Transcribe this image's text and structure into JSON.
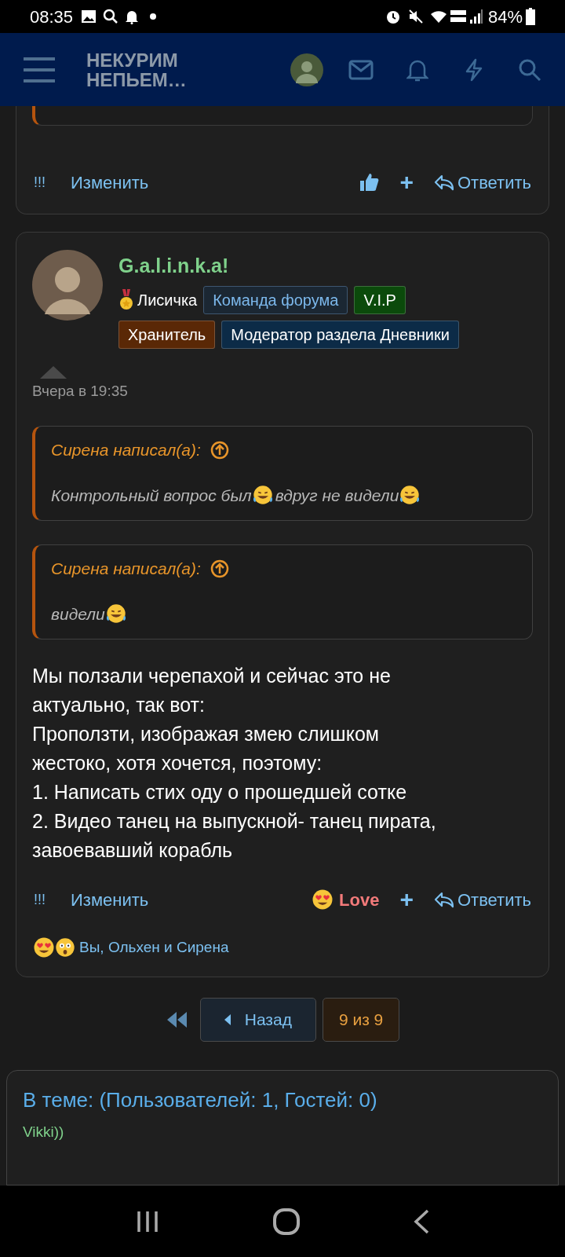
{
  "status_bar": {
    "time": "08:35",
    "battery": "84%"
  },
  "header": {
    "logo_lines": [
      "НЕКУРИМ",
      "НЕПЬЕМ…"
    ]
  },
  "posts": [
    {
      "partial": true,
      "actions": {
        "report": "!!!",
        "edit": "Изменить",
        "reaction": {
          "kind": "like"
        },
        "add": "+",
        "reply": "Ответить"
      }
    },
    {
      "partial": false,
      "author": "G.a.l.i.n.k.a!",
      "rank": "Лисичка",
      "badge_rows": [
        [
          {
            "label": "Команда форума",
            "kind": "outline",
            "color": "#1b2733"
          },
          {
            "label": "V.I.P",
            "kind": "solid",
            "color": "#0b4a0b"
          }
        ],
        [
          {
            "label": "Хранитель",
            "kind": "solid",
            "color": "#5a2806"
          },
          {
            "label": "Модератор раздела Дневники",
            "kind": "solid",
            "color": "#0c2b47"
          }
        ]
      ],
      "date": "Вчера в 19:35",
      "quotes": [
        {
          "author": "Сирена написал(а):",
          "parts": [
            {
              "text": "Контрольный вопрос был",
              "emoji_after": true
            },
            {
              "text": "вдруг не видели",
              "emoji_after": true
            }
          ]
        },
        {
          "author": "Сирена написал(а):",
          "parts": [
            {
              "text": "видели",
              "emoji_after": true
            }
          ]
        }
      ],
      "body": [
        "Мы ползали черепахой и сейчас это не актуально, так вот:",
        "Проползти, изображая змею слишком жестоко, хотя хочется, поэтому:",
        "1. Написать стих оду о прошедшей сотке",
        "2. Видео танец на выпускной- танец пирата, завоевавший корабль"
      ],
      "actions": {
        "report": "!!!",
        "edit": "Изменить",
        "reaction": {
          "kind": "love",
          "label": "Love"
        },
        "add": "+",
        "reply": "Ответить"
      },
      "reactions_summary": "Вы, Ольхен и Сирена"
    }
  ],
  "pagination": {
    "back": "Назад",
    "pages": [
      {
        "label": "9 из 9",
        "selected": true
      }
    ]
  },
  "online": {
    "title": "В теме: (Пользователей: 1, Гостей: 0)",
    "users": [
      "Vikki))"
    ]
  }
}
